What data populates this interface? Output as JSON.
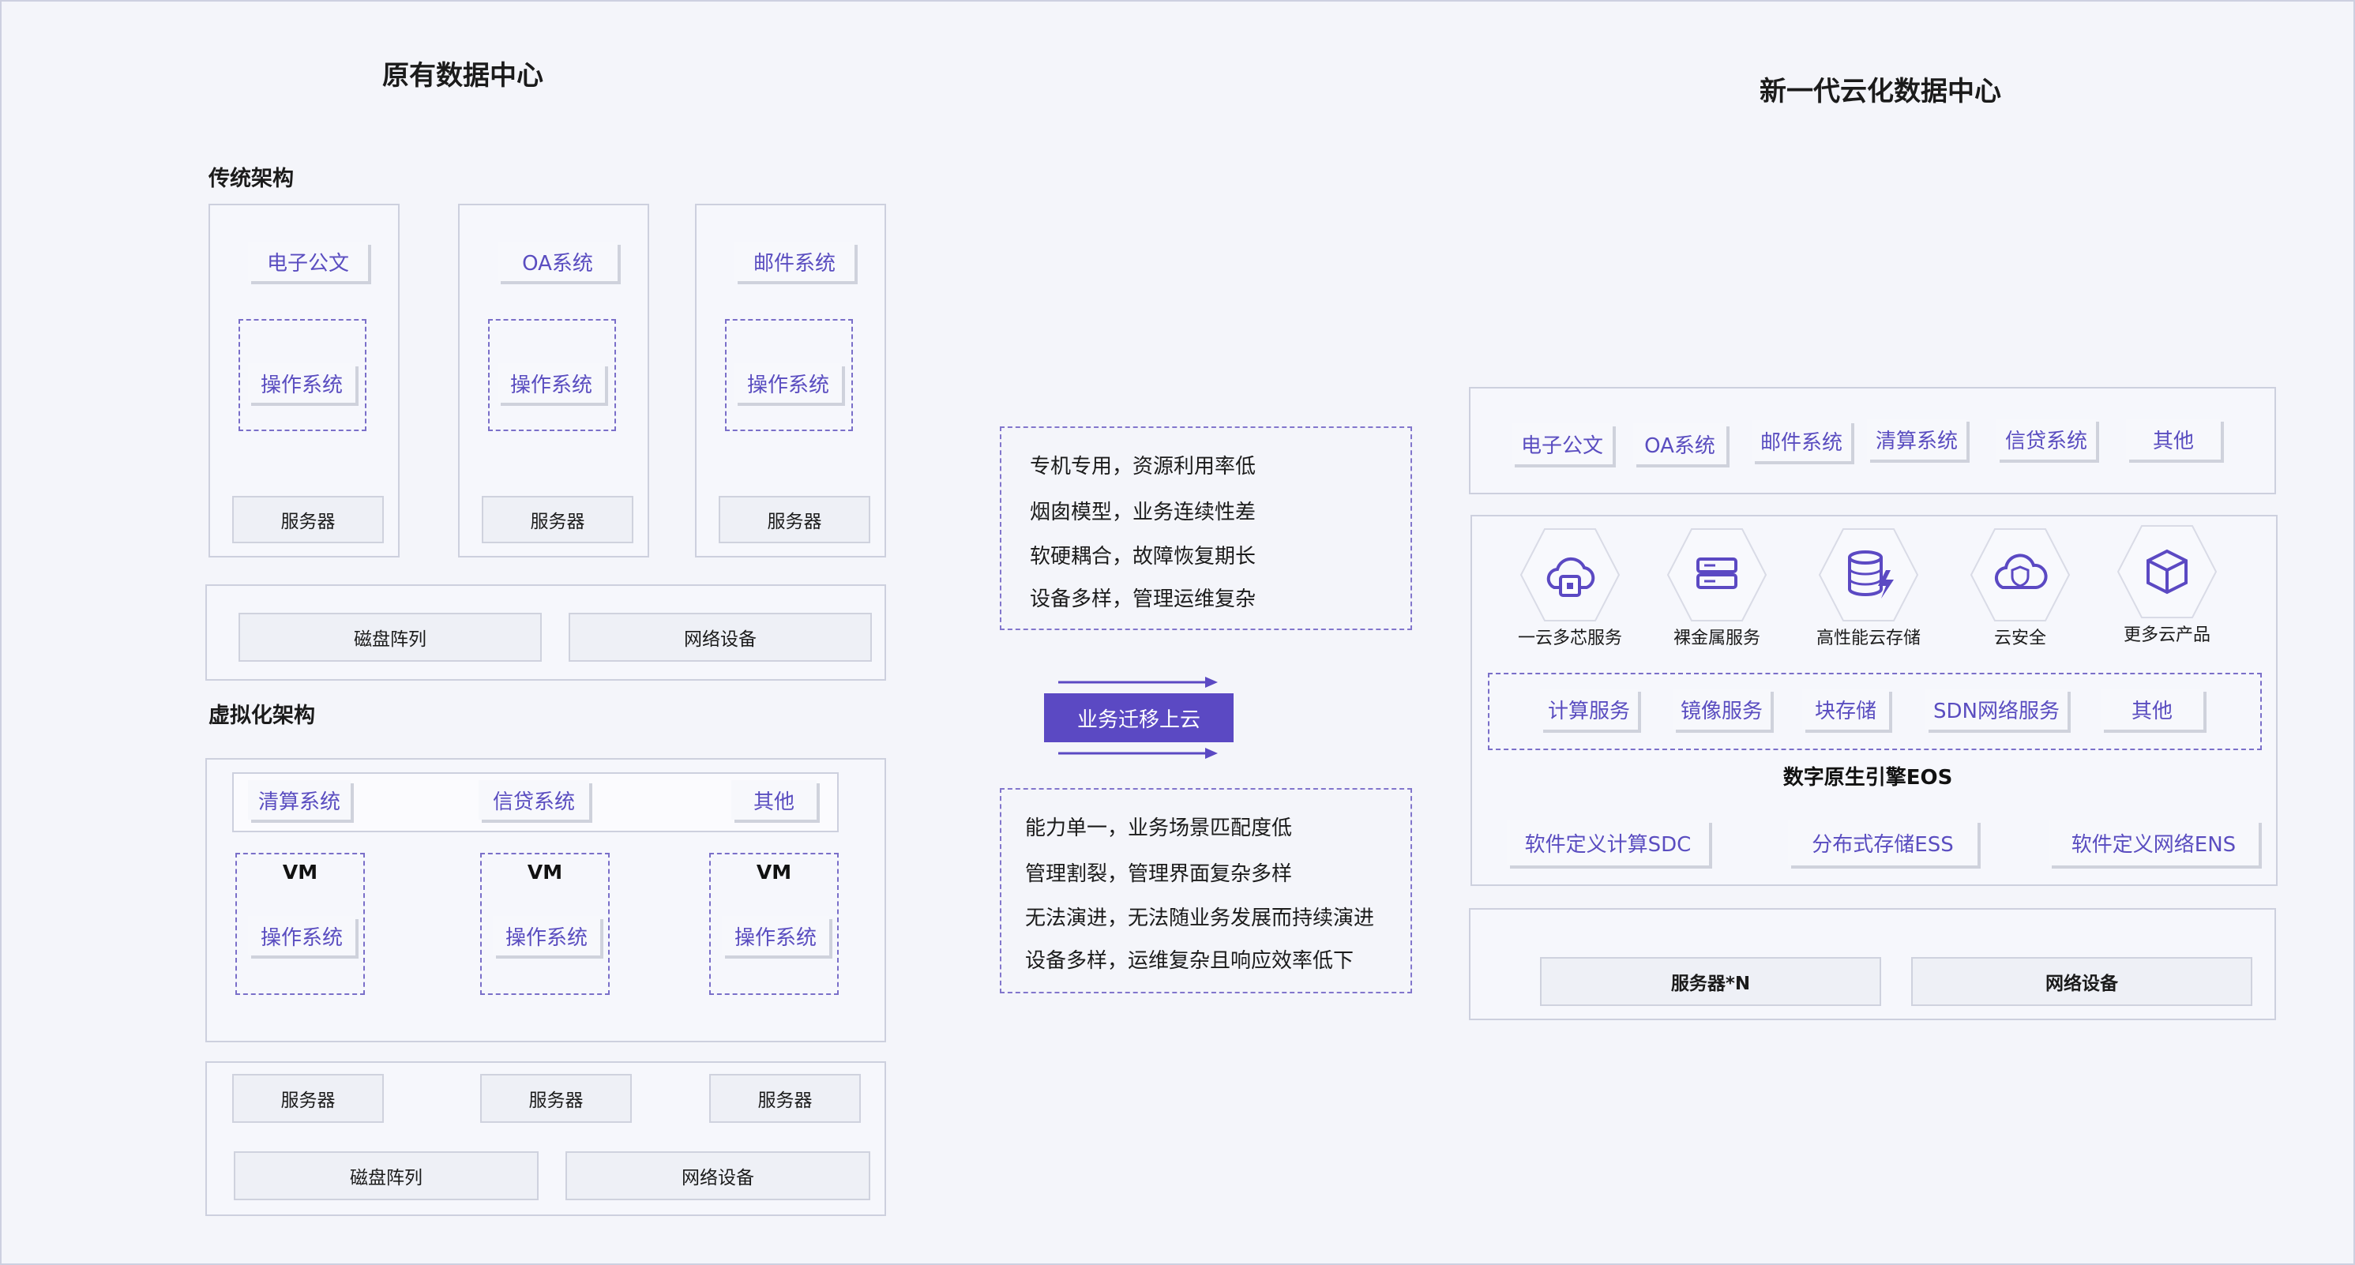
{
  "titles": {
    "left": "原有数据中心",
    "right": "新一代云化数据中心"
  },
  "traditional": {
    "heading": "传统架构",
    "columns": [
      {
        "app": "电子公文",
        "os": "操作系统",
        "server": "服务器"
      },
      {
        "app": "OA系统",
        "os": "操作系统",
        "server": "服务器"
      },
      {
        "app": "邮件系统",
        "os": "操作系统",
        "server": "服务器"
      }
    ],
    "storage": "磁盘阵列",
    "network": "网络设备"
  },
  "virtual": {
    "heading": "虚拟化架构",
    "apps": [
      "清算系统",
      "信贷系统",
      "其他"
    ],
    "vms": [
      {
        "label": "VM",
        "os": "操作系统"
      },
      {
        "label": "VM",
        "os": "操作系统"
      },
      {
        "label": "VM",
        "os": "操作系统"
      }
    ],
    "servers": [
      "服务器",
      "服务器",
      "服务器"
    ],
    "storage": "磁盘阵列",
    "network": "网络设备"
  },
  "problems_top": [
    "专机专用，资源利用率低",
    "烟囱模型，业务连续性差",
    "软硬耦合，故障恢复期长",
    "设备多样，管理运维复杂"
  ],
  "migrate_label": "业务迁移上云",
  "problems_bottom": [
    "能力单一，业务场景匹配度低",
    "管理割裂，管理界面复杂多样",
    "无法演进，无法随业务发展而持续演进",
    "设备多样，运维复杂且响应效率低下"
  ],
  "cloud": {
    "apps": [
      "电子公文",
      "OA系统",
      "邮件系统",
      "清算系统",
      "信贷系统",
      "其他"
    ],
    "services": [
      {
        "label": "一云多芯服务",
        "icon": "chip-cloud-icon"
      },
      {
        "label": "裸金属服务",
        "icon": "server-stack-icon"
      },
      {
        "label": "高性能云存储",
        "icon": "database-bolt-icon"
      },
      {
        "label": "云安全",
        "icon": "cloud-shield-icon"
      },
      {
        "label": "更多云产品",
        "icon": "cube-icon"
      }
    ],
    "compute": [
      "计算服务",
      "镜像服务",
      "块存储",
      "SDN网络服务",
      "其他"
    ],
    "eos": "数字原生引擎EOS",
    "software_defined": [
      "软件定义计算SDC",
      "分布式存储ESS",
      "软件定义网络ENS"
    ],
    "hardware": [
      "服务器*N",
      "网络设备"
    ]
  },
  "colors": {
    "accent": "#5b49c3",
    "label_text": "#5a4dc0",
    "border": "#cdd0de",
    "background": "#f4f5fa"
  }
}
